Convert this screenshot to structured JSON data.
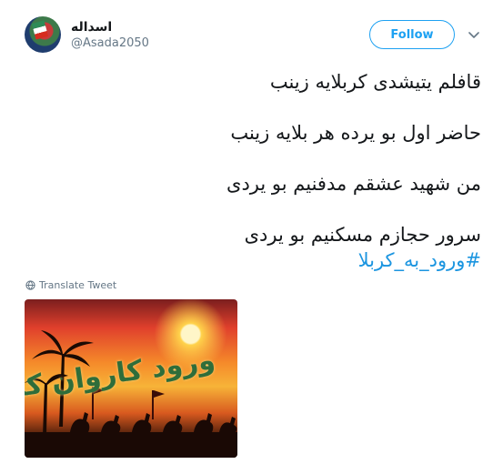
{
  "author": {
    "display_name": "اسداله",
    "handle": "@Asada2050"
  },
  "actions": {
    "follow_label": "Follow"
  },
  "tweet": {
    "lines": [
      "قافلم یتیشدی کربلایه زینب",
      "حاضر اول بو یرده هر بلایه زینب",
      "من شهید عشقم مدفنیم بو یردی",
      "سرور حجازم مسکنیم بو یردی"
    ],
    "hashtag": "#ورود_به_کربلا"
  },
  "translate": {
    "label": "Translate Tweet"
  },
  "media": {
    "overlay_text": "ورود کاروان کربلا"
  },
  "colors": {
    "accent": "#1da1f2",
    "hashtag": "#1b95e0",
    "secondary_text": "#657786"
  },
  "icons": {
    "chevron": "chevron-down-icon",
    "globe": "globe-icon"
  }
}
